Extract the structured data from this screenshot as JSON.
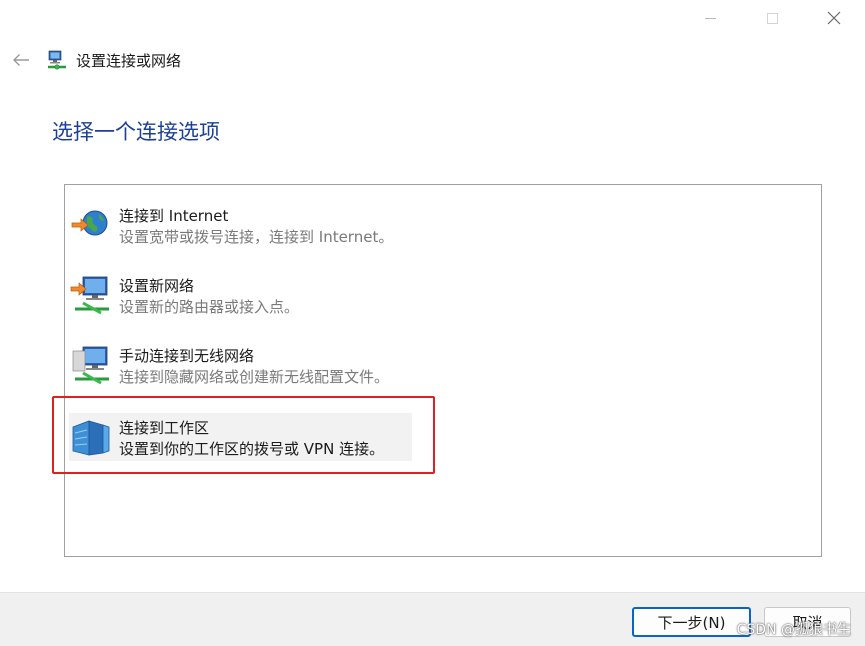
{
  "window": {
    "title": "设置连接或网络"
  },
  "page": {
    "heading": "选择一个连接选项"
  },
  "options": [
    {
      "title": "连接到 Internet",
      "description": "设置宽带或拨号连接，连接到 Internet。",
      "icon": "globe-network-icon",
      "selected": false
    },
    {
      "title": "设置新网络",
      "description": "设置新的路由器或接入点。",
      "icon": "new-network-icon",
      "selected": false
    },
    {
      "title": "手动连接到无线网络",
      "description": "连接到隐藏网络或创建新无线配置文件。",
      "icon": "wireless-network-icon",
      "selected": false
    },
    {
      "title": "连接到工作区",
      "description": "设置到你的工作区的拨号或 VPN 连接。",
      "icon": "workplace-icon",
      "selected": true
    }
  ],
  "buttons": {
    "next": "下一步(N)",
    "cancel": "取消"
  },
  "watermark": "CSDN @孤狼书生",
  "colors": {
    "heading": "#1c3f94",
    "highlight": "#e02020",
    "primary_border": "#0a64c8"
  }
}
